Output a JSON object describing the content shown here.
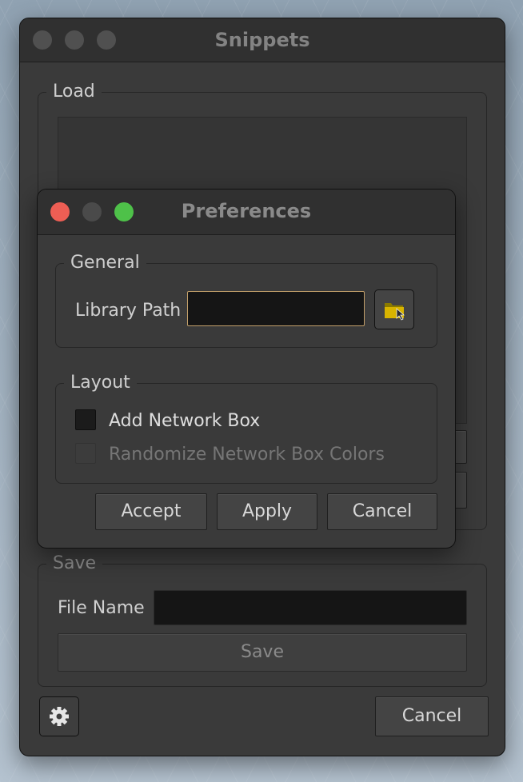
{
  "main_window": {
    "title": "Snippets",
    "load_label": "Load",
    "save_label": "Save",
    "file_name_label": "File Name",
    "file_name_value": "",
    "save_button": "Save",
    "cancel_button": "Cancel",
    "settings_icon": "gear-icon"
  },
  "prefs_dialog": {
    "title": "Preferences",
    "general_label": "General",
    "library_path_label": "Library Path",
    "library_path_value": "",
    "browse_icon": "folder-icon",
    "layout_label": "Layout",
    "add_network_box_label": "Add Network Box",
    "add_network_box_checked": false,
    "randomize_colors_label": "Randomize Network Box Colors",
    "randomize_colors_enabled": false,
    "accept_button": "Accept",
    "apply_button": "Apply",
    "cancel_button": "Cancel"
  },
  "colors": {
    "close": "#ed5e54",
    "minimize": "#4a4a4a",
    "zoom": "#4ec149",
    "focus": "#c3a06a",
    "folder": "#d8b400"
  }
}
